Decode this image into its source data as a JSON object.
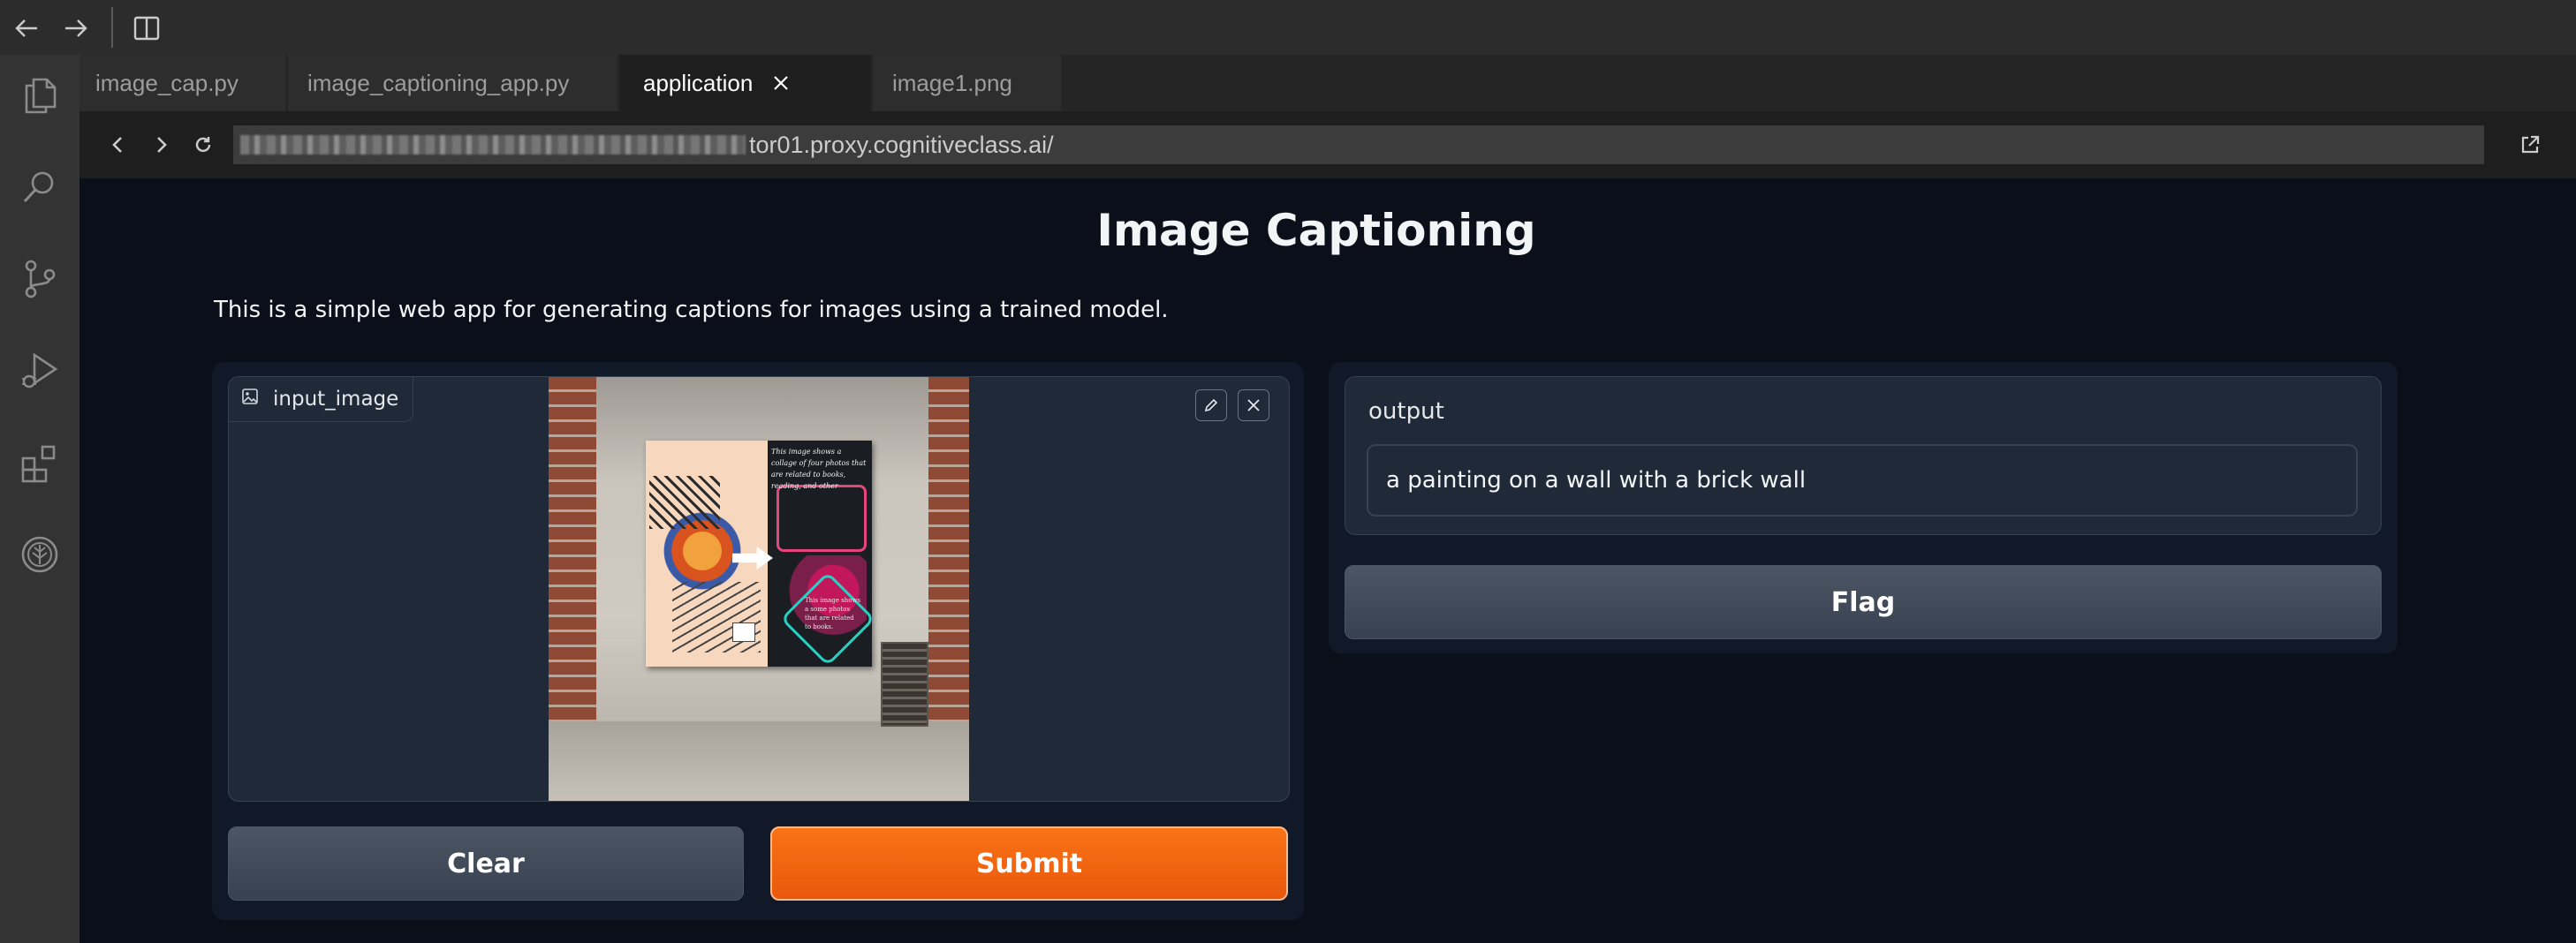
{
  "browser": {
    "tabs": [
      {
        "label": "image_cap.py",
        "active": false
      },
      {
        "label": "image_captioning_app.py",
        "active": false
      },
      {
        "label": "application",
        "active": true
      },
      {
        "label": "image1.png",
        "active": false
      }
    ],
    "url_visible": "tor01.proxy.cognitiveclass.ai/"
  },
  "app": {
    "title": "Image Captioning",
    "description": "This is a simple web app for generating captions for images using a trained model.",
    "input": {
      "label": "input_image"
    },
    "buttons": {
      "clear": "Clear",
      "submit": "Submit",
      "flag": "Flag"
    },
    "output": {
      "label": "output",
      "value": "a painting on a wall with a brick wall"
    },
    "poster_text": {
      "left": "This image shows a collage of four photos that are related to books, reading, and other",
      "right": "This image shows a some photos that are related to books."
    }
  },
  "colors": {
    "app_bg": "#0b0f19",
    "panel_bg": "#111827",
    "block_bg": "#1f2937",
    "border": "#374151",
    "submit_orange": "#f0690f",
    "secondary_btn": "#4b5563"
  },
  "icons": {
    "back": "arrow-left-icon",
    "forward": "arrow-right-icon",
    "split": "split-editor-icon",
    "explorer": "files-icon",
    "search": "search-icon",
    "scm": "source-control-icon",
    "debug": "run-debug-icon",
    "extensions": "extensions-icon",
    "skills": "skills-network-icon",
    "close": "close-icon",
    "reload": "reload-icon",
    "open_external": "open-external-icon",
    "edit": "pencil-icon",
    "image": "image-icon"
  }
}
